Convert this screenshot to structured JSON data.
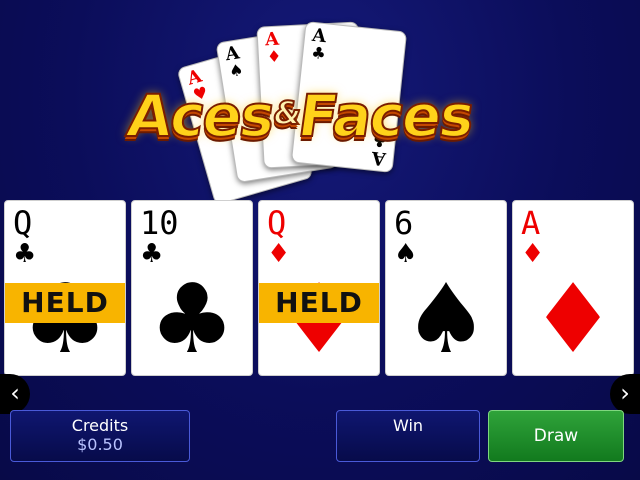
{
  "game": {
    "title_part1": "Aces",
    "title_amp": "&",
    "title_part2": "Faces"
  },
  "logo_cards": [
    {
      "rank": "A",
      "suit": "♥",
      "color": "#e00000"
    },
    {
      "rank": "A",
      "suit": "♠",
      "color": "#000000"
    },
    {
      "rank": "A",
      "suit": "♦",
      "color": "#e00000"
    },
    {
      "rank": "A",
      "suit": "♣",
      "color": "#000000"
    }
  ],
  "hand": [
    {
      "rank": "Q",
      "suit": "♣",
      "color": "#000000",
      "held": true,
      "held_label": "HELD"
    },
    {
      "rank": "10",
      "suit": "♣",
      "color": "#000000",
      "held": false,
      "held_label": ""
    },
    {
      "rank": "Q",
      "suit": "♦",
      "color": "#e00000",
      "held": true,
      "held_label": "HELD"
    },
    {
      "rank": "6",
      "suit": "♠",
      "color": "#000000",
      "held": false,
      "held_label": ""
    },
    {
      "rank": "A",
      "suit": "♦",
      "color": "#e00000",
      "held": false,
      "held_label": ""
    }
  ],
  "nav": {
    "left_icon": "chevron-left-icon",
    "right_icon": "chevron-right-icon",
    "left_glyph": "‹",
    "right_glyph": "›"
  },
  "footer": {
    "credits_label": "Credits",
    "credits_value": "$0.50",
    "win_label": "Win",
    "draw_label": "Draw"
  },
  "colors": {
    "background": "#0b0d5a",
    "held": "#f8b400",
    "draw": "#1f8f2a",
    "accent_text": "#b9c3ff"
  }
}
